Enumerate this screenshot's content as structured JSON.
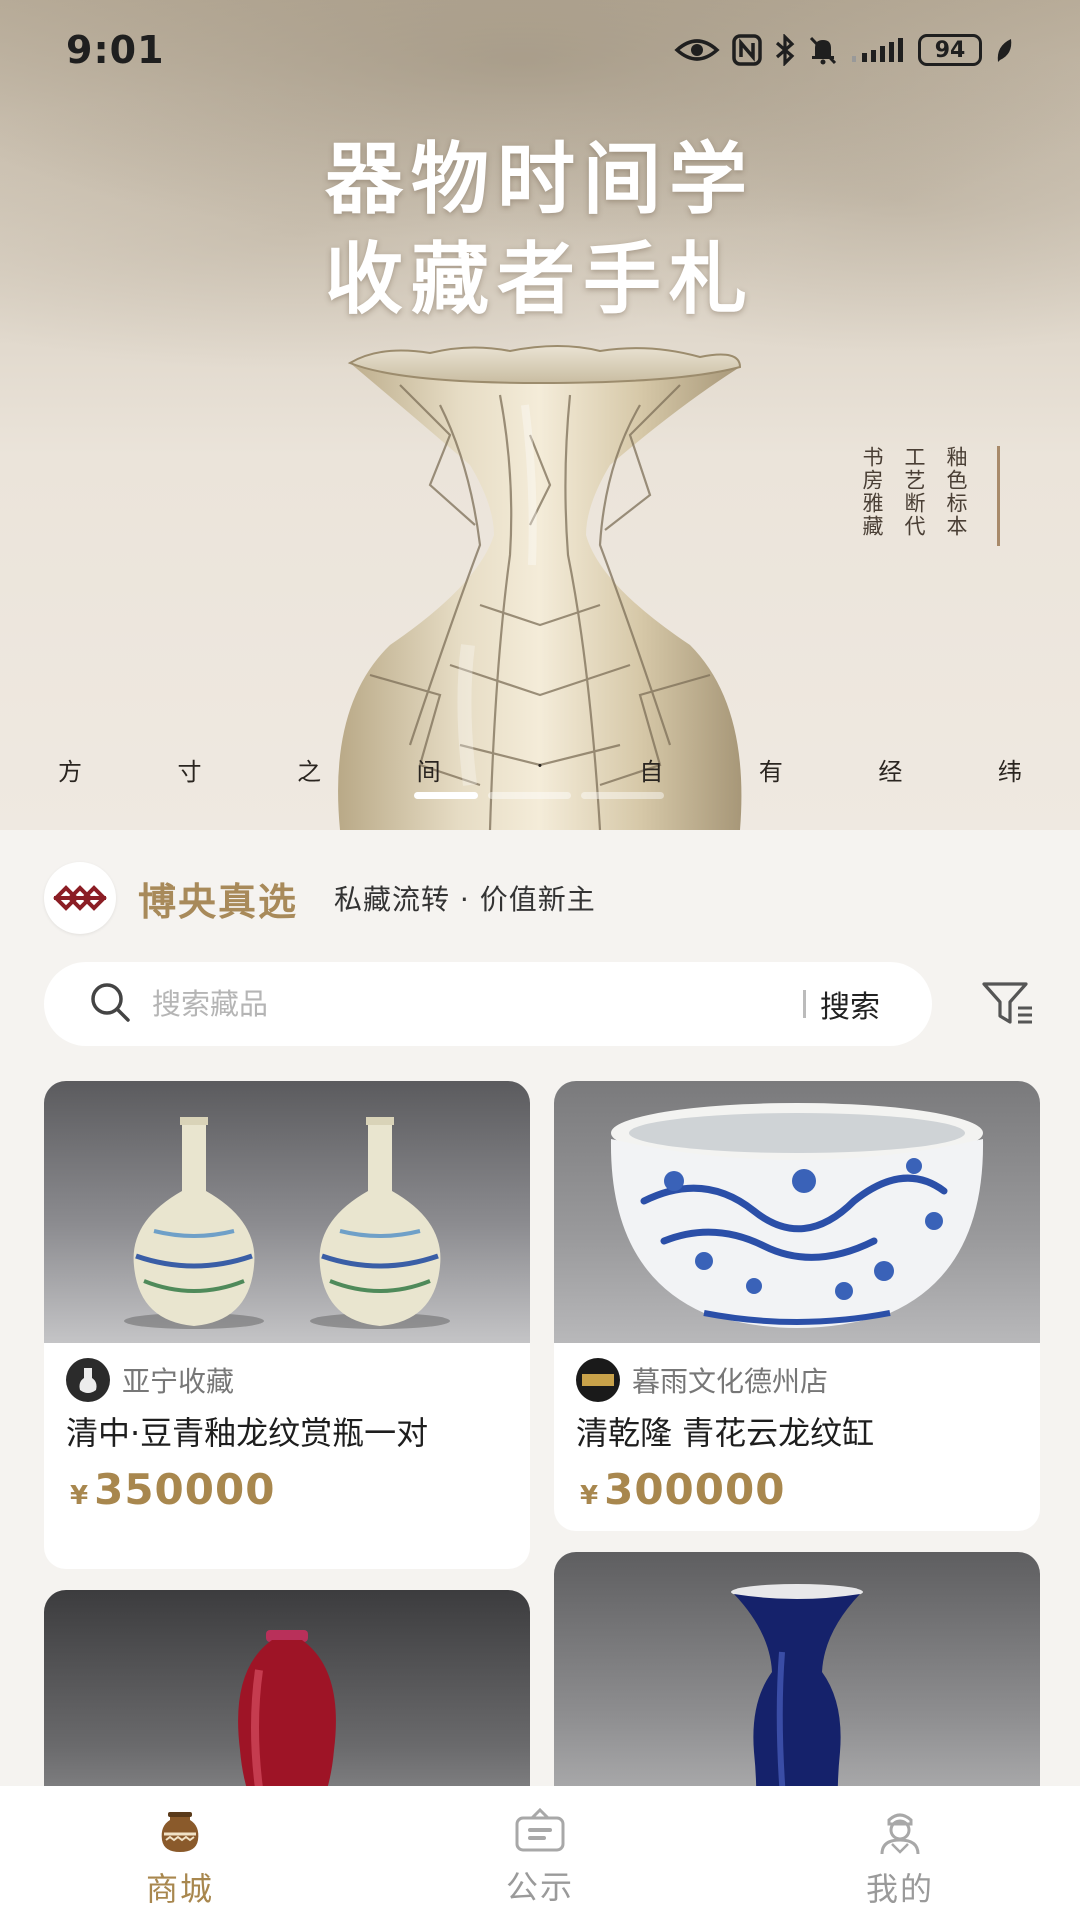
{
  "status_bar": {
    "time": "9:01",
    "battery": "94"
  },
  "hero": {
    "title_line1": "器物时间学",
    "title_line2": "收藏者手札",
    "vertical_columns": [
      "釉色标本",
      "工艺断代",
      "书房雅藏"
    ],
    "caption_chars": [
      "方",
      "寸",
      "之",
      "间",
      "·",
      "自",
      "有",
      "经",
      "纬"
    ],
    "carousel_count": 3,
    "carousel_active": 0
  },
  "brand": {
    "name": "博央真选",
    "slogan": "私藏流转 · 价值新主"
  },
  "search": {
    "placeholder": "搜索藏品",
    "button_label": "搜索"
  },
  "products": [
    {
      "shop": "亚宁收藏",
      "title": "清中·豆青釉龙纹赏瓶一对",
      "currency": "¥",
      "price": "350000"
    },
    {
      "shop": "暮雨文化德州店",
      "title": "清乾隆 青花云龙纹缸",
      "currency": "¥",
      "price": "300000"
    },
    {
      "shop": "",
      "title": "",
      "currency": "",
      "price": ""
    },
    {
      "shop": "",
      "title": "",
      "currency": "",
      "price": ""
    }
  ],
  "nav": [
    {
      "label": "商城",
      "icon": "jar-icon",
      "active": true
    },
    {
      "label": "公示",
      "icon": "notice-icon",
      "active": false
    },
    {
      "label": "我的",
      "icon": "profile-icon",
      "active": false
    }
  ],
  "colors": {
    "accent": "#a8874e",
    "brand_red": "#8b1d24",
    "page_bg": "#f5f3f0"
  }
}
